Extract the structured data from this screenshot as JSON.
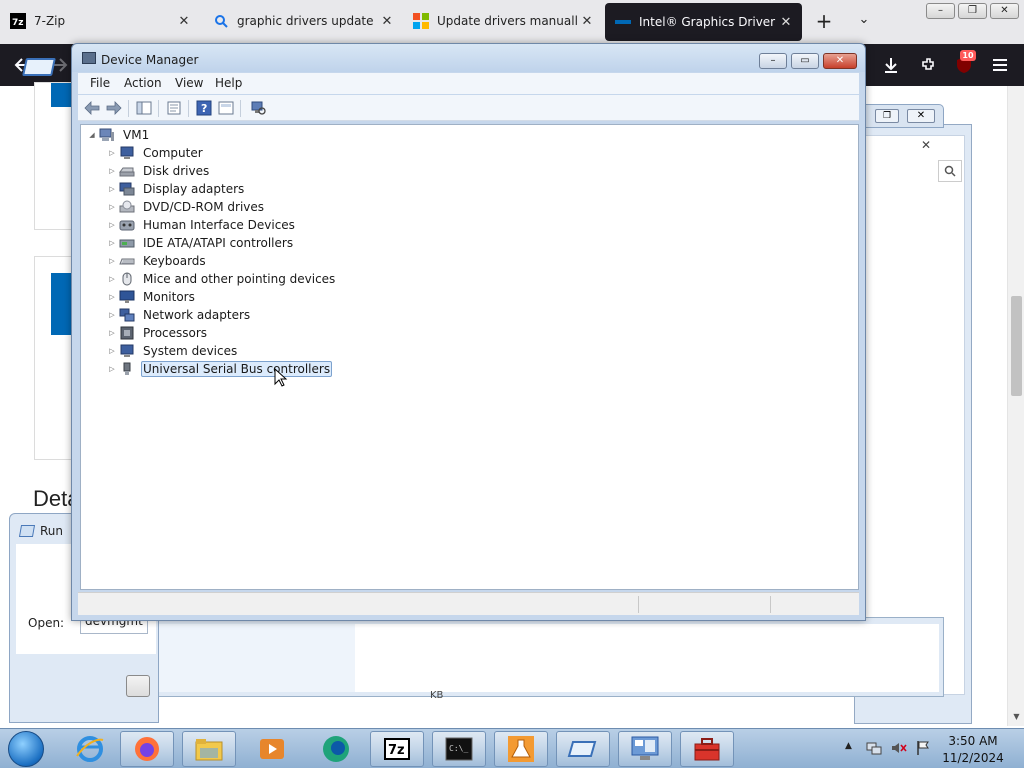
{
  "browser": {
    "tabs": [
      {
        "title": "7-Zip",
        "icon": "7zip-icon"
      },
      {
        "title": "graphic drivers update - Se",
        "icon": "search-icon"
      },
      {
        "title": "Update drivers manually in",
        "icon": "microsoft-icon"
      },
      {
        "title": "Intel® Graphics Driver for",
        "icon": "intel-icon",
        "active": true
      }
    ],
    "new_tab_glyph": "+",
    "tab_list_glyph": "⌄",
    "window_controls": {
      "minimize": "–",
      "restore": "❐",
      "close": "✕"
    },
    "extensions_badge": "10"
  },
  "webpage": {
    "heading": "Deta",
    "accent": "#0068b5"
  },
  "run_dialog": {
    "title": "Run",
    "open_label": "Open:",
    "open_value": "devmgmt"
  },
  "properties_footer_text": "KB",
  "device_manager": {
    "title": "Device Manager",
    "menu": [
      "File",
      "Action",
      "View",
      "Help"
    ],
    "toolbar": [
      "back-icon",
      "forward-icon",
      "show-hide-console-tree-icon",
      "properties-icon",
      "help-icon",
      "view-icon",
      "scan-hardware-icon"
    ],
    "root": "VM1",
    "categories": [
      {
        "label": "Computer",
        "icon": "computer-icon"
      },
      {
        "label": "Disk drives",
        "icon": "disk-drive-icon"
      },
      {
        "label": "Display adapters",
        "icon": "display-adapter-icon"
      },
      {
        "label": "DVD/CD-ROM drives",
        "icon": "dvd-drive-icon"
      },
      {
        "label": "Human Interface Devices",
        "icon": "hid-icon"
      },
      {
        "label": "IDE ATA/ATAPI controllers",
        "icon": "ide-controller-icon"
      },
      {
        "label": "Keyboards",
        "icon": "keyboard-icon"
      },
      {
        "label": "Mice and other pointing devices",
        "icon": "mouse-icon"
      },
      {
        "label": "Monitors",
        "icon": "monitor-icon"
      },
      {
        "label": "Network adapters",
        "icon": "network-adapter-icon"
      },
      {
        "label": "Processors",
        "icon": "processor-icon"
      },
      {
        "label": "System devices",
        "icon": "system-devices-icon"
      },
      {
        "label": "Universal Serial Bus controllers",
        "icon": "usb-icon",
        "selected": true
      }
    ]
  },
  "taskbar": {
    "pinned": [
      "internet-explorer-icon",
      "firefox-icon",
      "file-explorer-icon",
      "media-player-icon",
      "edge-icon",
      "7zip-icon",
      "command-prompt-icon",
      "lab-flask-icon",
      "run-icon",
      "control-panel-icon",
      "toolbox-icon"
    ],
    "tray_up_glyph": "▲",
    "clock_time": "3:50 AM",
    "clock_date": "11/2/2024"
  }
}
